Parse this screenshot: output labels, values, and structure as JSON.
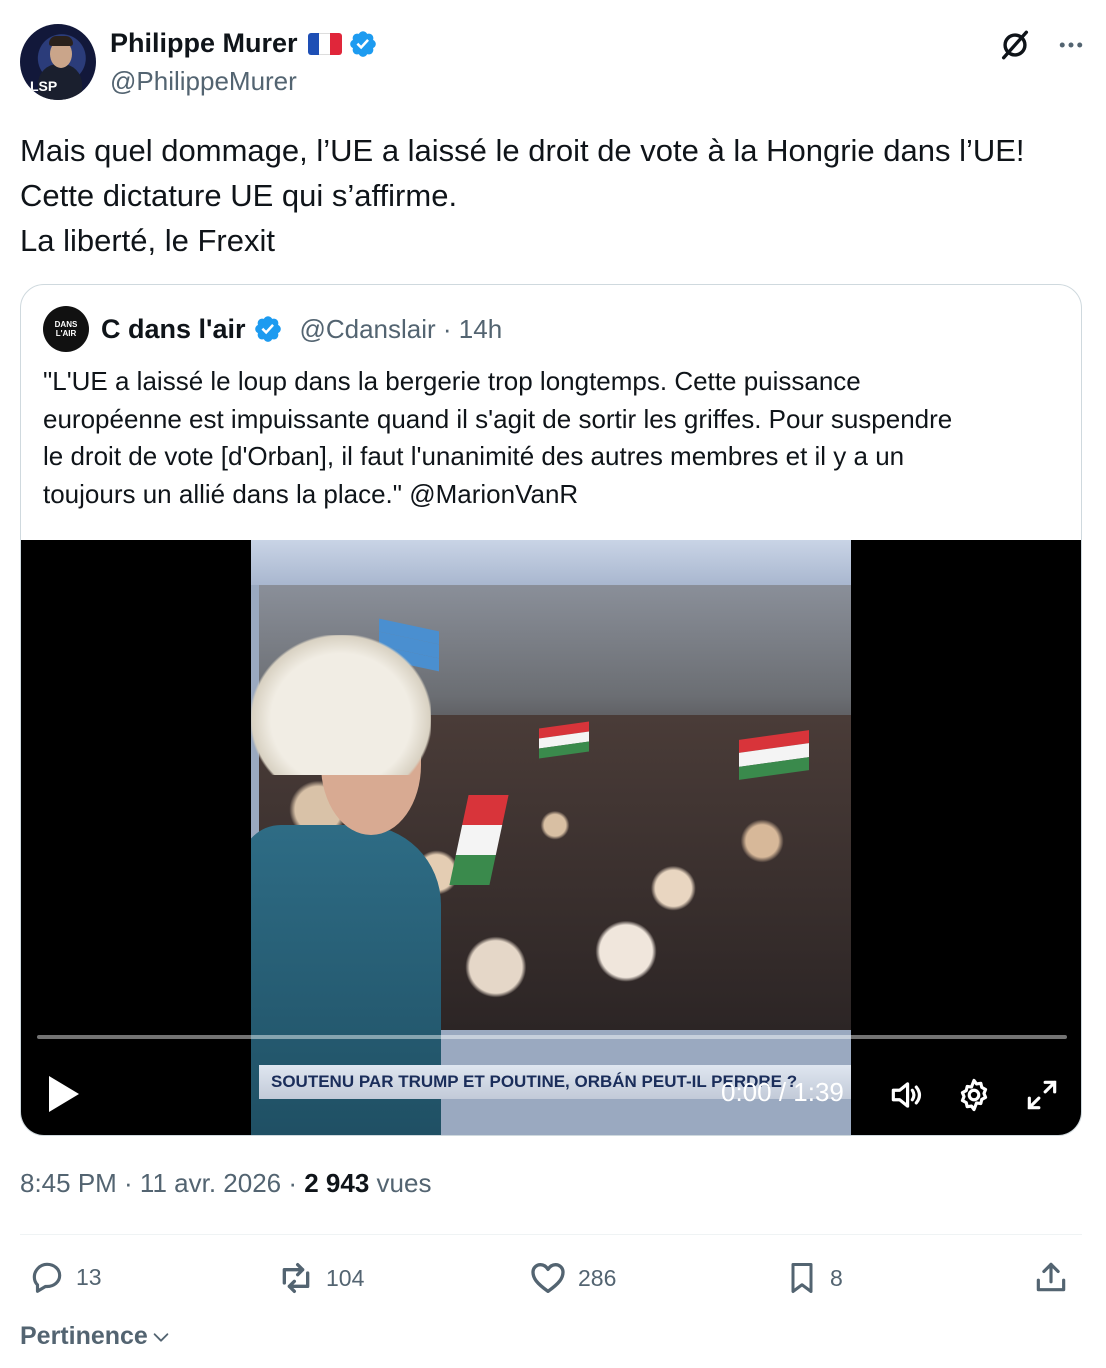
{
  "author": {
    "display_name": "Philippe Murer",
    "flag_emoji": "🇫🇷",
    "handle": "@PhilippeMurer",
    "avatar_text": "LSP",
    "verified_color": "#1d9bf0"
  },
  "tweet": {
    "lines": [
      "Mais quel dommage, l’UE a laissé le droit de vote à la Hongrie dans l’UE!",
      "Cette dictature UE qui s’affirme.",
      "La liberté, le Frexit"
    ]
  },
  "quote": {
    "avatar_line1": "DANS",
    "avatar_line2": "L'AIR",
    "display_name": "C dans l'air",
    "handle_time": "@Cdanslair · 14h",
    "lines": [
      "\"L'UE a laissé le loup dans la bergerie trop longtemps. Cette puissance",
      "européenne est impuissante quand il s'agit de sortir les griffes. Pour suspendre",
      "le droit de vote [d'Orban], il faut l'unanimité des autres membres et il y a un",
      "toujours un allié dans la place.\" @MarionVanR"
    ],
    "video": {
      "banner": "SOUTENU PAR TRUMP ET POUTINE, ORBÁN PEUT-IL PERDRE ?",
      "time": "0:00 / 1:39",
      "progress": 0
    }
  },
  "meta": {
    "timestamp": "8:45 PM · 11 avr. 2026 · ",
    "views_count": "2 943",
    "views_label": " vues"
  },
  "actions": {
    "replies": "13",
    "reposts": "104",
    "likes": "286",
    "bookmarks": "8"
  },
  "sort": {
    "label": "Pertinence"
  }
}
